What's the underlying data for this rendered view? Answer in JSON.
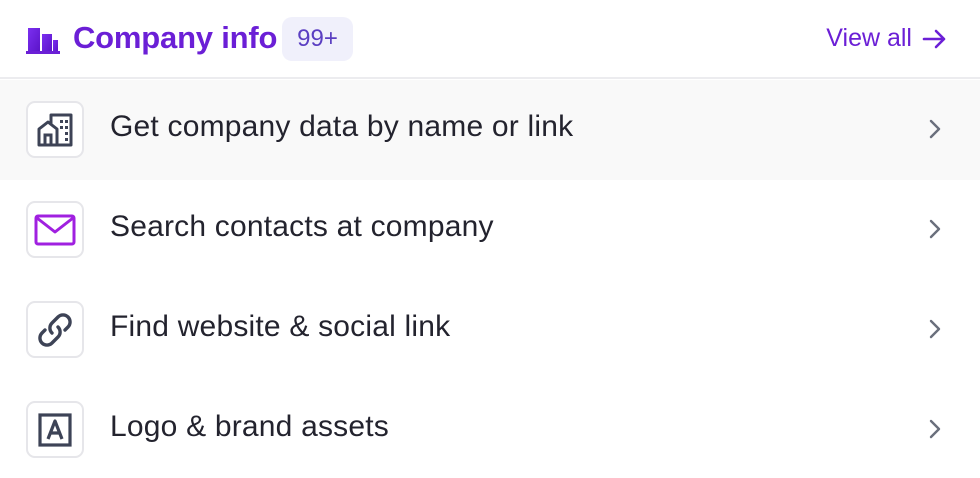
{
  "header": {
    "title": "Company info",
    "badge": "99+",
    "view_all_label": "View all",
    "brand_icon": "buildings-icon",
    "view_all_icon": "arrow-right-icon"
  },
  "items": [
    {
      "label": "Get company data by name or link",
      "icon": "building-icon",
      "active": true
    },
    {
      "label": "Search contacts at company",
      "icon": "envelope-icon",
      "active": false
    },
    {
      "label": "Find website & social link",
      "icon": "link-icon",
      "active": false
    },
    {
      "label": "Logo & brand assets",
      "icon": "letter-a-logo-icon",
      "active": false
    }
  ],
  "colors": {
    "accent": "#6b1fd6",
    "badge_bg": "#f0f0fb",
    "text": "#23232e",
    "icon_stroke": "#3d4356",
    "envelope": "#a020e0",
    "active_row_bg": "#f9f9f9"
  }
}
